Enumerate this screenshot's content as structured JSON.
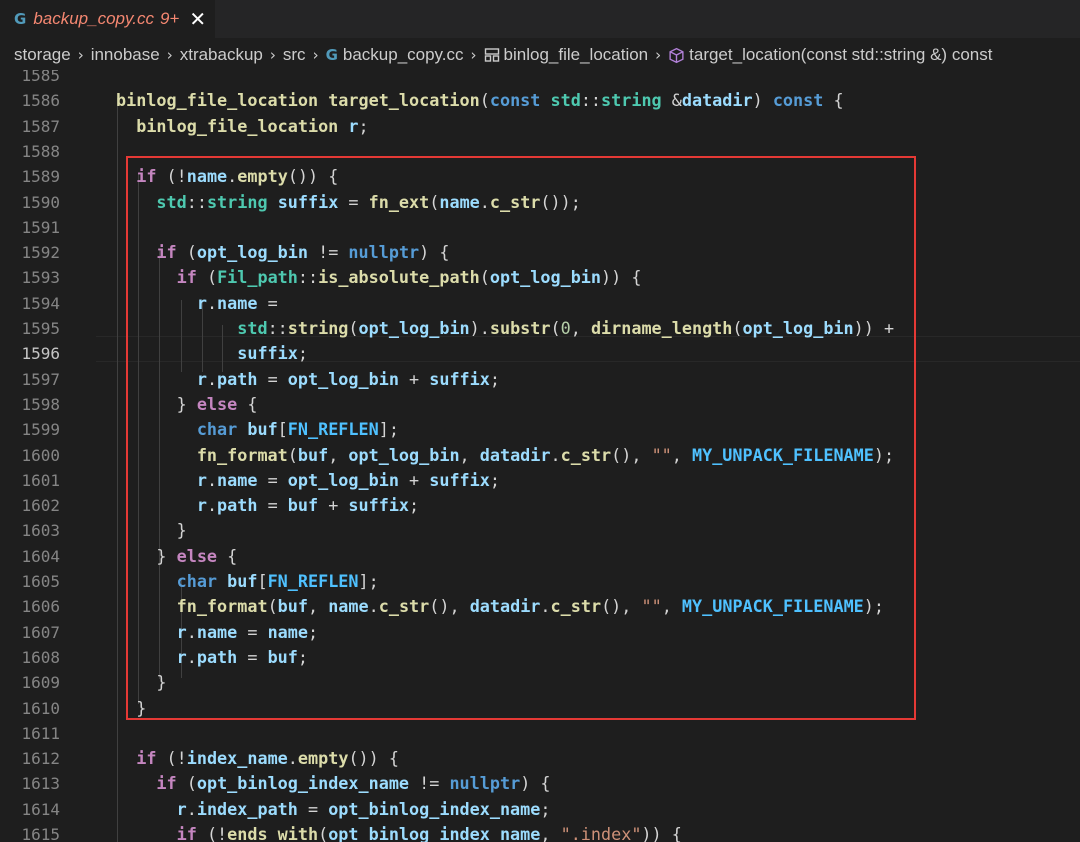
{
  "tab": {
    "icon": "G",
    "filename": "backup_copy.cc",
    "badge": "9+",
    "close": "✕"
  },
  "breadcrumb": {
    "items": [
      "storage",
      "innobase",
      "xtrabackup",
      "src",
      "backup_copy.cc",
      "binlog_file_location",
      "target_location(const std::string &) const"
    ],
    "separator": "›"
  },
  "editor": {
    "active_line": "1596",
    "line_numbers": [
      "1585",
      "1586",
      "1587",
      "1588",
      "1589",
      "1590",
      "1591",
      "1592",
      "1593",
      "1594",
      "1595",
      "1596",
      "1597",
      "1598",
      "1599",
      "1600",
      "1601",
      "1602",
      "1603",
      "1604",
      "1605",
      "1606",
      "1607",
      "1608",
      "1609",
      "1610",
      "1611",
      "1612",
      "1613",
      "1614",
      "1615"
    ],
    "lines": [
      "",
      "binlog_file_location target_location(const std::string &datadir) const {",
      "  binlog_file_location r;",
      "",
      "  if (!name.empty()) {",
      "    std::string suffix = fn_ext(name.c_str());",
      "",
      "    if (opt_log_bin != nullptr) {",
      "      if (Fil_path::is_absolute_path(opt_log_bin)) {",
      "        r.name =",
      "            std::string(opt_log_bin).substr(0, dirname_length(opt_log_bin)) +",
      "            suffix;",
      "        r.path = opt_log_bin + suffix;",
      "      } else {",
      "        char buf[FN_REFLEN];",
      "        fn_format(buf, opt_log_bin, datadir.c_str(), \"\", MY_UNPACK_FILENAME);",
      "        r.name = opt_log_bin + suffix;",
      "        r.path = buf + suffix;",
      "      }",
      "    } else {",
      "      char buf[FN_REFLEN];",
      "      fn_format(buf, name.c_str(), datadir.c_str(), \"\", MY_UNPACK_FILENAME);",
      "      r.name = name;",
      "      r.path = buf;",
      "    }",
      "  }",
      "",
      "  if (!index_name.empty()) {",
      "    if (opt_binlog_index_name != nullptr) {",
      "      r.index_path = opt_binlog_index_name;",
      "      if (!ends_with(opt_binlog_index_name, \".index\")) {"
    ]
  },
  "colors": {
    "background": "#1e1e1e",
    "keyword": "#569cd6",
    "control": "#c586c0",
    "function": "#dcdcaa",
    "type": "#4ec9b0",
    "variable": "#9cdcfe",
    "string": "#ce9178",
    "highlight_box": "#e53935"
  }
}
